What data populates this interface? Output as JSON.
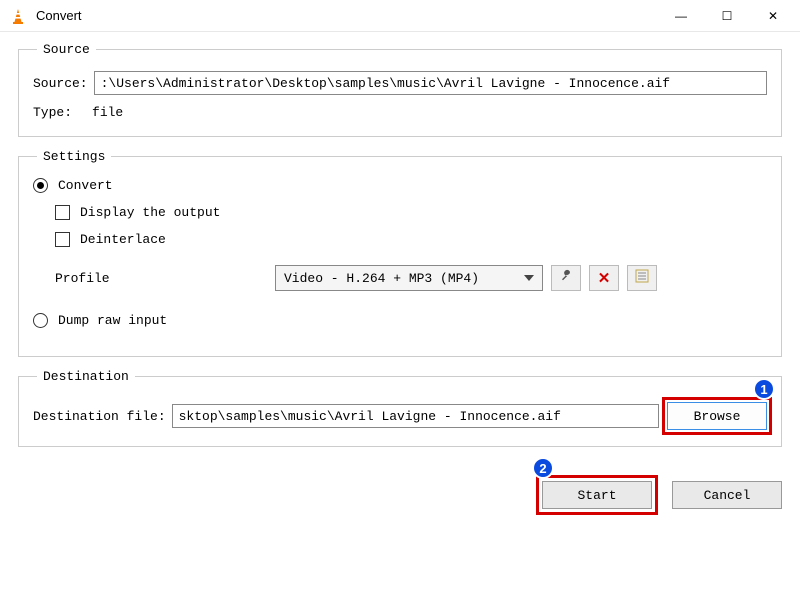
{
  "window": {
    "title": "Convert",
    "min": "—",
    "max": "☐",
    "close": "✕"
  },
  "source": {
    "legend": "Source",
    "source_label": "Source:",
    "source_value": ":\\Users\\Administrator\\Desktop\\samples\\music\\Avril Lavigne - Innocence.aif",
    "type_label": "Type:",
    "type_value": "file"
  },
  "settings": {
    "legend": "Settings",
    "convert": "Convert",
    "display_output": "Display the output",
    "deinterlace": "Deinterlace",
    "profile_label": "Profile",
    "profile_value": "Video - H.264 + MP3 (MP4)",
    "dump": "Dump raw input"
  },
  "destination": {
    "legend": "Destination",
    "file_label": "Destination file:",
    "file_value": "sktop\\samples\\music\\Avril Lavigne - Innocence.aif",
    "browse": "Browse"
  },
  "actions": {
    "start": "Start",
    "cancel": "Cancel"
  },
  "annotations": {
    "badge1": "1",
    "badge2": "2"
  }
}
